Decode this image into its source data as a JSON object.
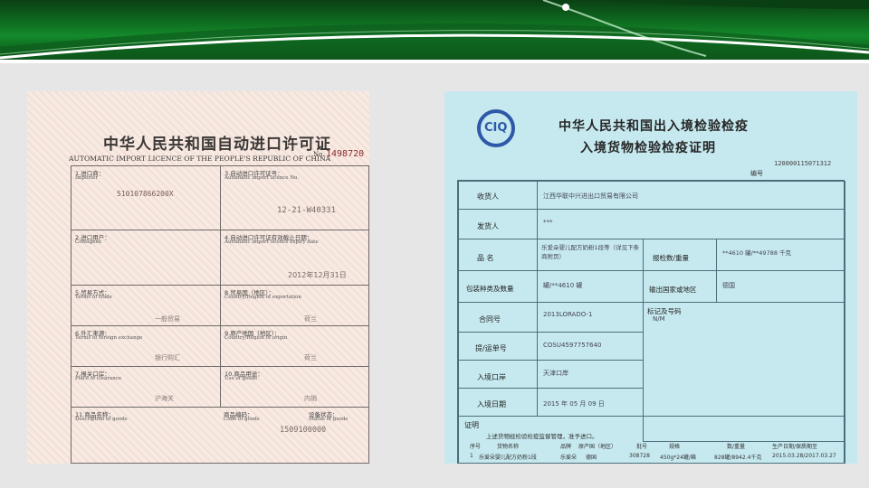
{
  "colors": {
    "banner_dark": "#0a3f13",
    "banner_light": "#138a2b",
    "slide_bg": "#e6e6e6",
    "licence_paper": "#f7eae3",
    "cert_paper": "#c6e9ef"
  },
  "licence": {
    "title": "中华人民共和国自动进口许可证",
    "subtitle": "AUTOMATIC IMPORT LICENCE OF THE PEOPLE'S REPUBLIC OF CHINA",
    "no_label": "No.",
    "no_value": "1498720",
    "fields": [
      {
        "label": "1.进口商：",
        "sub": "Importer",
        "value": "510107866200X"
      },
      {
        "label": "3.自动进口许可证号：",
        "sub": "Automatic import licence No.",
        "value": "12-21-W40331"
      },
      {
        "label": "2.进口用户：",
        "sub": "Consignee",
        "value": ""
      },
      {
        "label": "4.自动进口许可证有效截止日期：",
        "sub": "Automatic import licence expiry date",
        "value": "2012年12月31日"
      },
      {
        "label": "5.贸易方式：",
        "sub": "Terms of trade",
        "value": "一般贸易"
      },
      {
        "label": "8.贸易国（地区）：",
        "sub": "Country/Region of exportation",
        "value": "荷兰"
      },
      {
        "label": "6.外汇来源：",
        "sub": "Terms of foreign exchange",
        "value": "银行购汇"
      },
      {
        "label": "9.原产地国（地区）：",
        "sub": "Country/Region of origin",
        "value": "荷兰"
      },
      {
        "label": "7.报关口岸：",
        "sub": "Place of clearance",
        "value": "沪海关"
      },
      {
        "label": "10.商品用途：",
        "sub": "Use of goods",
        "value": "内销"
      },
      {
        "label": "11.商品名称：",
        "sub": "Description of goods",
        "value": ""
      },
      {
        "label": "商品编码：",
        "sub": "Code of goods",
        "value": "1509100000"
      },
      {
        "label": "设备状态：",
        "sub": "Status of goods",
        "value": ""
      }
    ]
  },
  "certificate": {
    "header_line1": "中华人民共和国出入境检验检疫",
    "header_line2": "入境货物检验检疫证明",
    "logo_text": "CIQ",
    "serial": "120000115071312",
    "no_label": "编号",
    "rows": [
      {
        "label": "收货人",
        "value": "江西华联中兴进出口贸易有限公司"
      },
      {
        "label": "发货人",
        "value": "***"
      },
      {
        "label": "品    名",
        "value": "乐爱朵婴儿配方奶粉1段等（详见下条商附页）"
      },
      {
        "label": "包装种类及数量",
        "value": "罐/**4610 罐"
      },
      {
        "label": "合同号",
        "value": "2013LORADO-1"
      },
      {
        "label": "提/运单号",
        "value": "COSU4597757640"
      },
      {
        "label": "入境口岸",
        "value": "天津口岸"
      },
      {
        "label": "入境日期",
        "value": "2015 年 05 月 09 日"
      }
    ],
    "right_cells": [
      {
        "label": "报检数/重量",
        "value": "**4610 罐/**49788 千克"
      },
      {
        "label": "输出国家或地区",
        "value": "德国"
      },
      {
        "label": "标记及号码",
        "value": "N/M"
      }
    ],
    "remarks_label": "证明",
    "remarks_text": "上述货物经检验检疫监督管理，准予进口。",
    "goods_header": [
      "序号",
      "货物名称",
      "品牌",
      "原产国（地区）",
      "批号",
      "规格",
      "数/重量",
      "生产日期/保质期至"
    ],
    "goods_row": [
      "1",
      "乐爱朵婴儿配方奶粉1段",
      "乐爱朵",
      "德国",
      "308728",
      "450g*24罐/箱",
      "828罐/8942.4千克",
      "2015.03.28/2017.03.27"
    ]
  }
}
